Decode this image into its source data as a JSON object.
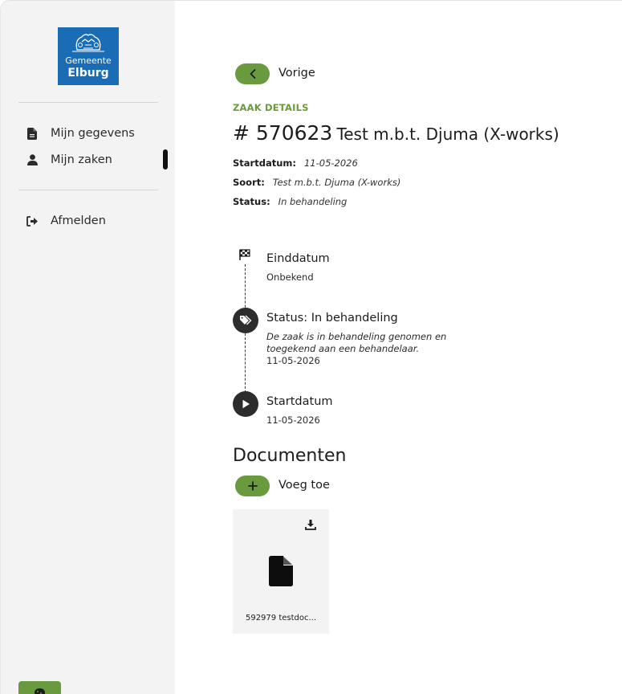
{
  "sidebar": {
    "logo": {
      "line1": "Gemeente",
      "line2": "Elburg"
    },
    "items": [
      {
        "label": "Mijn gegevens",
        "icon": "document-icon"
      },
      {
        "label": "Mijn zaken",
        "icon": "user-icon",
        "active": true
      }
    ],
    "logout": {
      "label": "Afmelden",
      "icon": "logout-icon"
    },
    "cookie_icon": "cookie-icon"
  },
  "main": {
    "back_label": "Vorige",
    "eyebrow": "ZAAK DETAILS",
    "case_number": "# 570623",
    "case_name": "Test m.b.t. Djuma (X-works)",
    "meta": [
      {
        "label": "Startdatum:",
        "value": "11-05-2026"
      },
      {
        "label": "Soort:",
        "value": "Test m.b.t. Djuma (X-works)"
      },
      {
        "label": "Status:",
        "value": "In behandeling"
      }
    ],
    "timeline": [
      {
        "title": "Einddatum",
        "text": "Onbekend",
        "icon": "flag-icon"
      },
      {
        "title": "Status: In behandeling",
        "description": "De zaak is in behandeling genomen en toegekend aan een behandelaar.",
        "date": "11-05-2026",
        "icon": "tag-icon"
      },
      {
        "title": "Startdatum",
        "date": "11-05-2026",
        "icon": "play-icon"
      }
    ],
    "documents": {
      "heading": "Documenten",
      "add_label": "Voeg toe",
      "items": [
        {
          "name": "592979 testdoc..."
        }
      ]
    }
  },
  "colors": {
    "accent": "#6a9a3e",
    "logo_blue": "#1a6cb4",
    "sidebar_bg": "#f3f3f3"
  }
}
